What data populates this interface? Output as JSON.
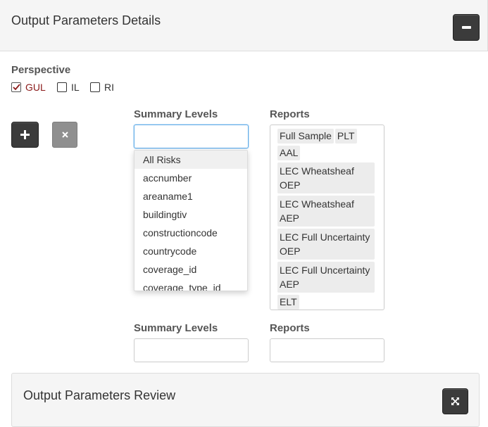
{
  "header": {
    "title": "Output Parameters Details"
  },
  "perspective": {
    "label": "Perspective",
    "options": [
      {
        "label": "GUL",
        "checked": true
      },
      {
        "label": "IL",
        "checked": false
      },
      {
        "label": "RI",
        "checked": false
      }
    ]
  },
  "editor": {
    "summary_levels_label": "Summary Levels",
    "reports_label": "Reports",
    "summary_input_value": "",
    "dropdown_options": [
      "All Risks",
      "accnumber",
      "areaname1",
      "buildingtiv",
      "constructioncode",
      "countrycode",
      "coverage_id",
      "coverage_type_id"
    ],
    "reports": [
      "Full Sample",
      "PLT",
      "AAL",
      "LEC Wheatsheaf OEP",
      "LEC Wheatsheaf AEP",
      "LEC Full Uncertainty OEP",
      "LEC Full Uncertainty AEP",
      "ELT"
    ]
  },
  "second_row": {
    "summary_levels_label": "Summary Levels",
    "reports_label": "Reports",
    "summary_input_value": "",
    "reports_input_value": ""
  },
  "review": {
    "title": "Output Parameters Review"
  },
  "icons": {
    "collapse": "minus-icon",
    "add": "plus-icon",
    "remove": "times-icon",
    "expand": "expand-icon",
    "check": "check-icon"
  },
  "colors": {
    "dark_button": "#3b3b3b",
    "remove_button": "#8f8f8f",
    "checked_label": "#8b1a1a",
    "focus_border": "#66afe9"
  }
}
